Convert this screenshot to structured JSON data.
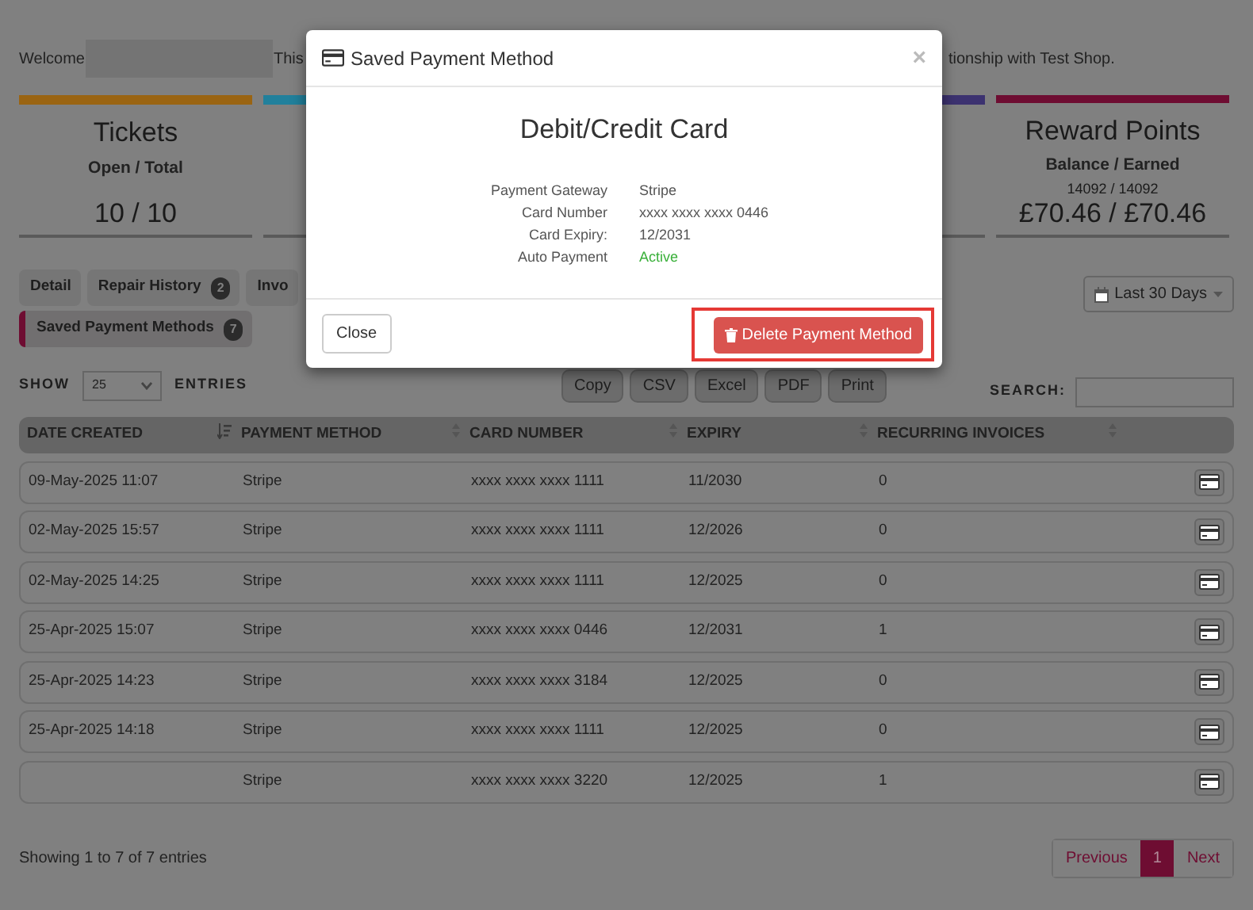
{
  "welcome": {
    "lead": "Welcome",
    "tail_start": "This",
    "tail_end": "tionship with Test Shop."
  },
  "stats": [
    {
      "title": "Tickets",
      "subtitle": "Open / Total",
      "value": "10 / 10",
      "color": "#9a6412"
    },
    {
      "color": "#21809c"
    },
    {
      "color": "#3c3270"
    },
    {
      "title": "Reward Points",
      "subtitle": "Balance / Earned",
      "detail": "14092 / 14092",
      "value": "£70.46 / £70.46",
      "color": "#6e0d32"
    }
  ],
  "tabs": [
    {
      "label": "Detail",
      "selected": false
    },
    {
      "label": "Repair History",
      "count": "2",
      "selected": false
    },
    {
      "label": "Invo",
      "selected": false
    },
    {
      "label": "Saved Payment Methods",
      "count": "7",
      "selected": true
    }
  ],
  "date_range": {
    "label": "Last 30 Days"
  },
  "length": {
    "label_before": "SHOW",
    "value": "25",
    "label_after": "ENTRIES"
  },
  "export_buttons": [
    "Copy",
    "CSV",
    "Excel",
    "PDF",
    "Print"
  ],
  "search": {
    "label": "SEARCH:"
  },
  "table": {
    "columns": [
      {
        "label": "DATE CREATED",
        "sorted": true
      },
      {
        "label": "PAYMENT METHOD",
        "sorted": false
      },
      {
        "label": "CARD NUMBER",
        "sorted": false
      },
      {
        "label": "EXPIRY",
        "sorted": false
      },
      {
        "label": "RECURRING INVOICES",
        "sorted": false
      }
    ],
    "rows": [
      {
        "date": "09-May-2025 11:07",
        "method": "Stripe",
        "card": "xxxx xxxx xxxx 1111",
        "expiry": "11/2030",
        "recurring": "0"
      },
      {
        "date": "02-May-2025 15:57",
        "method": "Stripe",
        "card": "xxxx xxxx xxxx 1111",
        "expiry": "12/2026",
        "recurring": "0"
      },
      {
        "date": "02-May-2025 14:25",
        "method": "Stripe",
        "card": "xxxx xxxx xxxx 1111",
        "expiry": "12/2025",
        "recurring": "0"
      },
      {
        "date": "25-Apr-2025 15:07",
        "method": "Stripe",
        "card": "xxxx xxxx xxxx 0446",
        "expiry": "12/2031",
        "recurring": "1"
      },
      {
        "date": "25-Apr-2025 14:23",
        "method": "Stripe",
        "card": "xxxx xxxx xxxx 3184",
        "expiry": "12/2025",
        "recurring": "0"
      },
      {
        "date": "25-Apr-2025 14:18",
        "method": "Stripe",
        "card": "xxxx xxxx xxxx 1111",
        "expiry": "12/2025",
        "recurring": "0"
      },
      {
        "method": "Stripe",
        "card": "xxxx xxxx xxxx 3220",
        "expiry": "12/2025",
        "recurring": "1"
      }
    ]
  },
  "footer_info": "Showing 1 to 7 of 7 entries",
  "pagination": [
    {
      "label": "Previous",
      "selected": false
    },
    {
      "label": "1",
      "selected": true
    },
    {
      "label": "Next",
      "selected": false
    }
  ],
  "modal": {
    "title": "Saved Payment Method",
    "close_icon": "×",
    "heading": "Debit/Credit Card",
    "details": [
      {
        "label": "Payment Gateway",
        "value": "Stripe",
        "kind": "text"
      },
      {
        "label": "Card Number",
        "value": "xxxx xxxx xxxx 0446",
        "kind": "text"
      },
      {
        "label": "Card Expiry:",
        "value": "12/2031",
        "kind": "text"
      },
      {
        "label": "Auto Payment",
        "value": "Active",
        "kind": "status"
      }
    ],
    "close_button": "Close",
    "delete_button": "Delete Payment Method",
    "delete_highlighted": true
  }
}
